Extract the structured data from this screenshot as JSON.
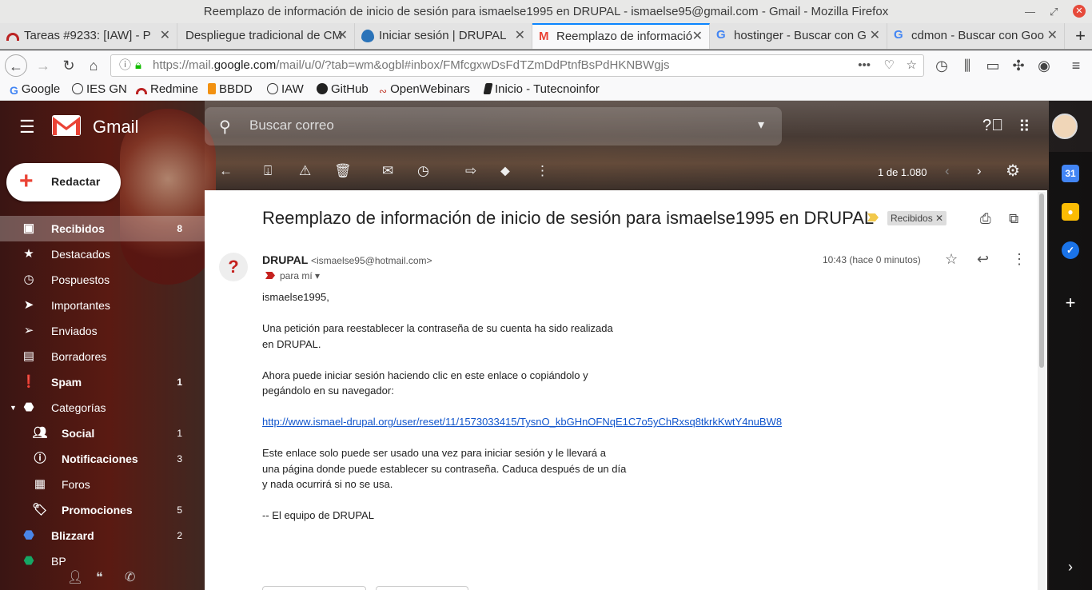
{
  "window": {
    "title": "Reemplazo de información de inicio de sesión para ismaelse1995 en DRUPAL - ismaelse95@gmail.com - Gmail - Mozilla Firefox"
  },
  "tabs": [
    {
      "label": "Tareas #9233: [IAW] - P"
    },
    {
      "label": "Despliegue tradicional de CM"
    },
    {
      "label": "Iniciar sesión | DRUPAL"
    },
    {
      "label": "Reemplazo de informació"
    },
    {
      "label": "hostinger - Buscar con G"
    },
    {
      "label": "cdmon - Buscar con Goo"
    }
  ],
  "url": {
    "prefix": "https://mail.",
    "domain": "google.com",
    "path": "/mail/u/0/?tab=wm&ogbl#inbox/FMfcgxwDsFdTZmDdPtnfBsPdHKNBWgjs"
  },
  "bookmarks": [
    "Google",
    "IES GN",
    "Redmine",
    "BBDD",
    "IAW",
    "GitHub",
    "OpenWebinars",
    "Inicio - Tutecnoinfor"
  ],
  "colors": {
    "accent": "#0a84ff",
    "gmail_red": "#ea4335",
    "link": "#1155cc"
  },
  "gmail": {
    "brand": "Gmail",
    "search_placeholder": "Buscar correo",
    "compose": "Redactar",
    "pager": "1 de 1.080",
    "nav": [
      {
        "label": "Recibidos",
        "count": "8",
        "icon": "inbox-icon"
      },
      {
        "label": "Destacados",
        "count": "",
        "icon": "star-icon"
      },
      {
        "label": "Pospuestos",
        "count": "",
        "icon": "clock-icon"
      },
      {
        "label": "Importantes",
        "count": "",
        "icon": "important-icon"
      },
      {
        "label": "Enviados",
        "count": "",
        "icon": "send-icon"
      },
      {
        "label": "Borradores",
        "count": "",
        "icon": "draft-icon"
      },
      {
        "label": "Spam",
        "count": "1",
        "icon": "spam-icon"
      },
      {
        "label": "Categorías",
        "count": "",
        "icon": "label-icon"
      },
      {
        "label": "Social",
        "count": "1",
        "icon": "people-icon"
      },
      {
        "label": "Notificaciones",
        "count": "3",
        "icon": "info-icon"
      },
      {
        "label": "Foros",
        "count": "",
        "icon": "forum-icon"
      },
      {
        "label": "Promociones",
        "count": "5",
        "icon": "tag-icon"
      },
      {
        "label": "Blizzard",
        "count": "2",
        "icon": "label-icon"
      },
      {
        "label": "BP",
        "count": "",
        "icon": "label-icon"
      }
    ],
    "mail": {
      "subject": "Reemplazo de información de inicio de sesión para ismaelse1995 en DRUPAL",
      "chip": "Recibidos",
      "sender_name": "DRUPAL",
      "sender_email": "<ismaelse95@hotmail.com>",
      "to": "para mí",
      "time": "10:43 (hace 0 minutos)",
      "greeting": "ismaelse1995,",
      "p1": "Una petición para reestablecer la contraseña de su cuenta ha sido realizada\nen DRUPAL.",
      "p2": "Ahora puede iniciar sesión haciendo clic en este enlace o copiándolo y\npegándolo en su navegador:",
      "link": "http://www.ismael-drupal.org/user/reset/11/1573033415/TysnO_kbGHnOFNqE1C7o5yChRxsq8tkrkKwtY4nuBW8",
      "p3": "Este enlace solo puede ser usado una vez para iniciar sesión y le llevará a\nuna página donde puede establecer su contraseña. Caduca después de un día\ny nada ocurrirá si no se usa.",
      "signature": "--  El equipo de DRUPAL"
    }
  }
}
